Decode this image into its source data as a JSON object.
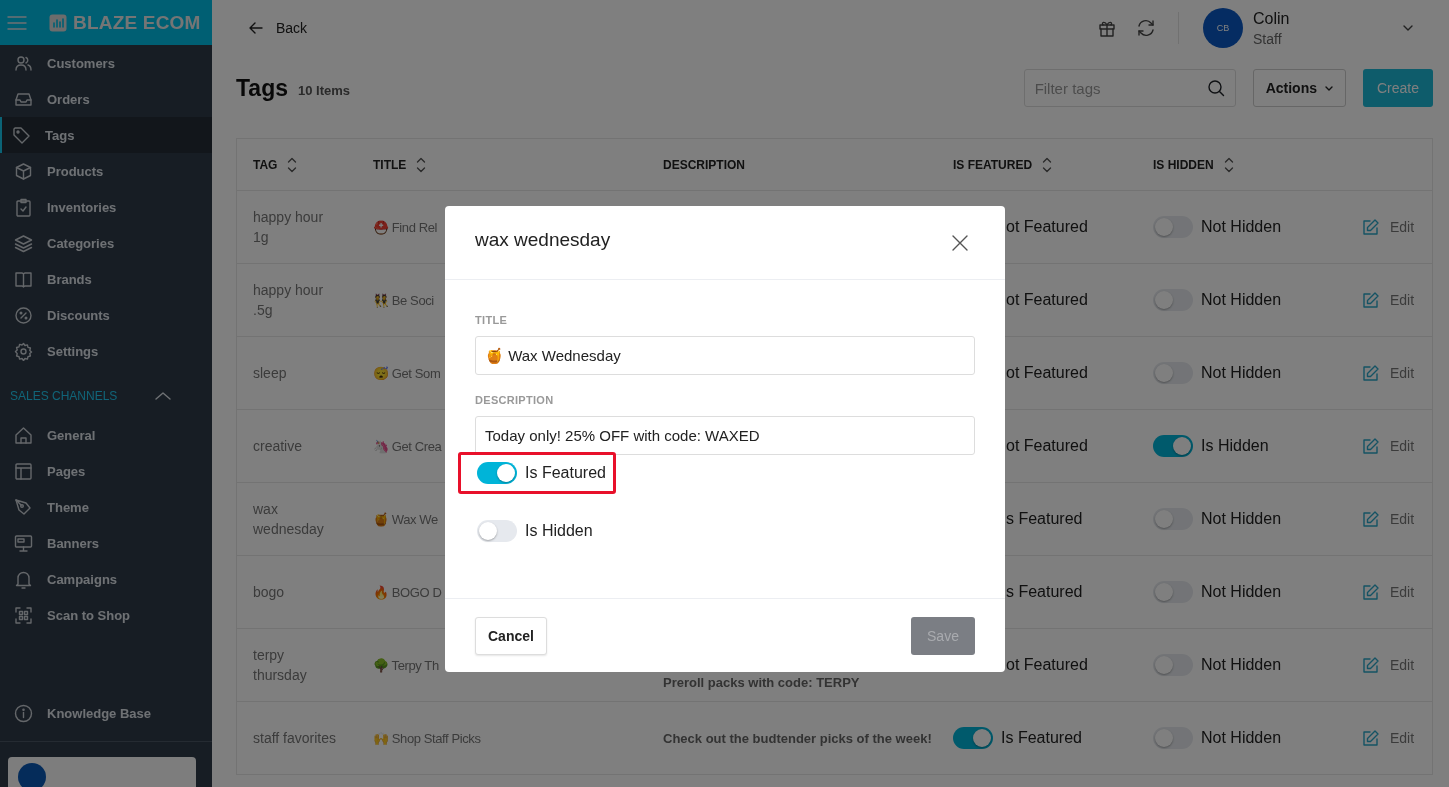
{
  "sidebar": {
    "brand": "BLAZE ECOM",
    "items": [
      {
        "label": "Customers",
        "selected": false
      },
      {
        "label": "Orders",
        "selected": false
      },
      {
        "label": "Tags",
        "selected": true
      },
      {
        "label": "Products",
        "selected": false
      },
      {
        "label": "Inventories",
        "selected": false
      },
      {
        "label": "Categories",
        "selected": false
      },
      {
        "label": "Brands",
        "selected": false
      },
      {
        "label": "Discounts",
        "selected": false
      },
      {
        "label": "Settings",
        "selected": false
      }
    ],
    "section": {
      "label": "SALES CHANNELS",
      "expanded": true
    },
    "channel_items": [
      {
        "label": "General",
        "selected": false
      },
      {
        "label": "Pages",
        "selected": false
      },
      {
        "label": "Theme",
        "selected": false
      },
      {
        "label": "Banners",
        "selected": false
      },
      {
        "label": "Campaigns",
        "selected": false
      },
      {
        "label": "Scan to Shop",
        "selected": false
      }
    ],
    "footer_items": [
      {
        "label": "Knowledge Base",
        "selected": false
      }
    ]
  },
  "topbar": {
    "back": "Back",
    "user": {
      "initials": "CB",
      "name": "Colin",
      "role": "Staff"
    }
  },
  "page": {
    "title": "Tags",
    "count": "10 Items",
    "filter": {
      "placeholder": "Filter tags"
    },
    "actions": "Actions",
    "create": "Create"
  },
  "table": {
    "columns": [
      {
        "label": "TAG",
        "sortable": true
      },
      {
        "label": "TITLE",
        "sortable": true
      },
      {
        "label": "DESCRIPTION",
        "sortable": false
      },
      {
        "label": "IS FEATURED",
        "sortable": true
      },
      {
        "label": "IS HIDDEN",
        "sortable": true
      }
    ],
    "rows": [
      {
        "tag": "happy hour 1g",
        "title": "⛑️ Find Rel",
        "featured": {
          "label": "ot Featured"
        },
        "hidden": {
          "on": false,
          "label": "Not Hidden"
        },
        "edit": "Edit"
      },
      {
        "tag": "happy hour .5g",
        "title": "👯 Be Soci",
        "featured": {
          "label": "ot Featured"
        },
        "hidden": {
          "on": false,
          "label": "Not Hidden"
        },
        "edit": "Edit"
      },
      {
        "tag": "sleep",
        "title": "😴 Get Som",
        "featured": {
          "label": "ot Featured"
        },
        "hidden": {
          "on": false,
          "label": "Not Hidden"
        },
        "edit": "Edit"
      },
      {
        "tag": "creative",
        "title": "🦄 Get Crea",
        "featured": {
          "label": "ot Featured"
        },
        "hidden": {
          "on": true,
          "label": "Is Hidden"
        },
        "edit": "Edit"
      },
      {
        "tag": "wax wednesday",
        "title": "🍯 Wax We",
        "featured": {
          "label": "s Featured"
        },
        "hidden": {
          "on": false,
          "label": "Not Hidden"
        },
        "edit": "Edit"
      },
      {
        "tag": "bogo",
        "title": "🔥 BOGO D",
        "featured": {
          "label": "s Featured"
        },
        "hidden": {
          "on": false,
          "label": "Not Hidden"
        },
        "edit": "Edit"
      },
      {
        "tag": "terpy thursday",
        "title": "🌳 Terpy Th",
        "description": "Preroll packs with code: TERPY",
        "featured": {
          "label": "ot Featured"
        },
        "hidden": {
          "on": false,
          "label": "Not Hidden"
        },
        "edit": "Edit"
      },
      {
        "tag": "staff favorites",
        "title": "🙌 Shop Staff Picks",
        "description": "Check out the budtender picks of the week!",
        "featured": {
          "on": true,
          "label": "Is Featured"
        },
        "hidden": {
          "on": false,
          "label": "Not Hidden"
        },
        "edit": "Edit"
      }
    ]
  },
  "modal": {
    "title": "wax wednesday",
    "fields": [
      {
        "label": "TITLE",
        "value": "🍯 Wax Wednesday"
      },
      {
        "label": "DESCRIPTION",
        "value": "Today only! 25% OFF with code: WAXED"
      }
    ],
    "toggles": [
      {
        "label": "Is Featured",
        "on": true,
        "highlighted": true
      },
      {
        "label": "Is Hidden",
        "on": false,
        "highlighted": false
      }
    ],
    "cancel": "Cancel",
    "save": {
      "label": "Save",
      "disabled": true
    }
  }
}
